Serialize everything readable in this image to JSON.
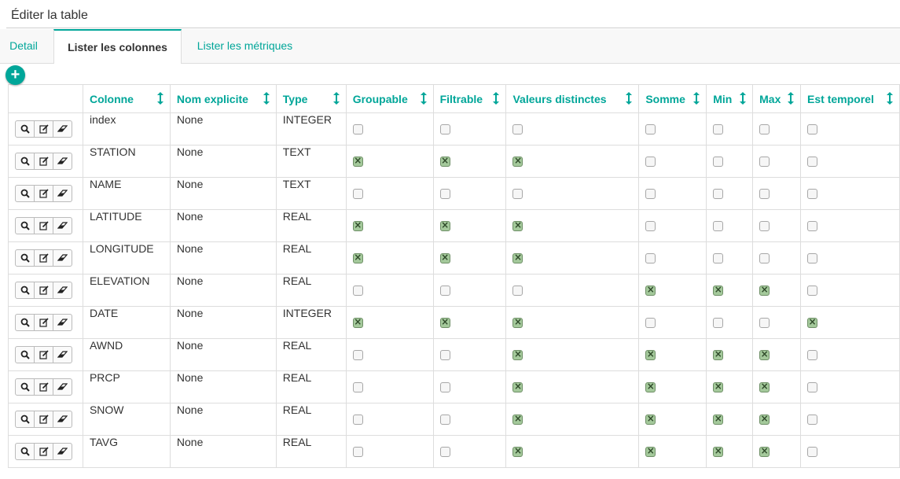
{
  "page": {
    "title": "Éditer la table"
  },
  "tabs": [
    {
      "label": "Detail",
      "active": false
    },
    {
      "label": "Lister les colonnes",
      "active": true
    },
    {
      "label": "Lister les métriques",
      "active": false
    }
  ],
  "add_button": {
    "label": "+"
  },
  "columns": [
    "Colonne",
    "Nom explicite",
    "Type",
    "Groupable",
    "Filtrable",
    "Valeurs distinctes",
    "Somme",
    "Min",
    "Max",
    "Est temporel"
  ],
  "rows": [
    {
      "colonne": "index",
      "nom_explicite": "None",
      "type": "INTEGER",
      "flags": [
        false,
        false,
        false,
        false,
        false,
        false,
        false
      ]
    },
    {
      "colonne": "STATION",
      "nom_explicite": "None",
      "type": "TEXT",
      "flags": [
        true,
        true,
        true,
        false,
        false,
        false,
        false
      ]
    },
    {
      "colonne": "NAME",
      "nom_explicite": "None",
      "type": "TEXT",
      "flags": [
        false,
        false,
        false,
        false,
        false,
        false,
        false
      ]
    },
    {
      "colonne": "LATITUDE",
      "nom_explicite": "None",
      "type": "REAL",
      "flags": [
        true,
        true,
        true,
        false,
        false,
        false,
        false
      ]
    },
    {
      "colonne": "LONGITUDE",
      "nom_explicite": "None",
      "type": "REAL",
      "flags": [
        true,
        true,
        true,
        false,
        false,
        false,
        false
      ]
    },
    {
      "colonne": "ELEVATION",
      "nom_explicite": "None",
      "type": "REAL",
      "flags": [
        false,
        false,
        false,
        true,
        true,
        true,
        false
      ]
    },
    {
      "colonne": "DATE",
      "nom_explicite": "None",
      "type": "INTEGER",
      "flags": [
        true,
        true,
        true,
        false,
        false,
        false,
        true
      ]
    },
    {
      "colonne": "AWND",
      "nom_explicite": "None",
      "type": "REAL",
      "flags": [
        false,
        false,
        true,
        true,
        true,
        true,
        false
      ]
    },
    {
      "colonne": "PRCP",
      "nom_explicite": "None",
      "type": "REAL",
      "flags": [
        false,
        false,
        true,
        true,
        true,
        true,
        false
      ]
    },
    {
      "colonne": "SNOW",
      "nom_explicite": "None",
      "type": "REAL",
      "flags": [
        false,
        false,
        true,
        true,
        true,
        true,
        false
      ]
    },
    {
      "colonne": "TAVG",
      "nom_explicite": "None",
      "type": "REAL",
      "flags": [
        false,
        false,
        true,
        true,
        true,
        true,
        false
      ]
    }
  ],
  "icons": {
    "actions": [
      "search-icon",
      "edit-icon",
      "eraser-icon"
    ],
    "sort": "sort-icon"
  },
  "colors": {
    "accent": "#00a699",
    "checked": "#a4c99b",
    "border": "#dddddd"
  }
}
